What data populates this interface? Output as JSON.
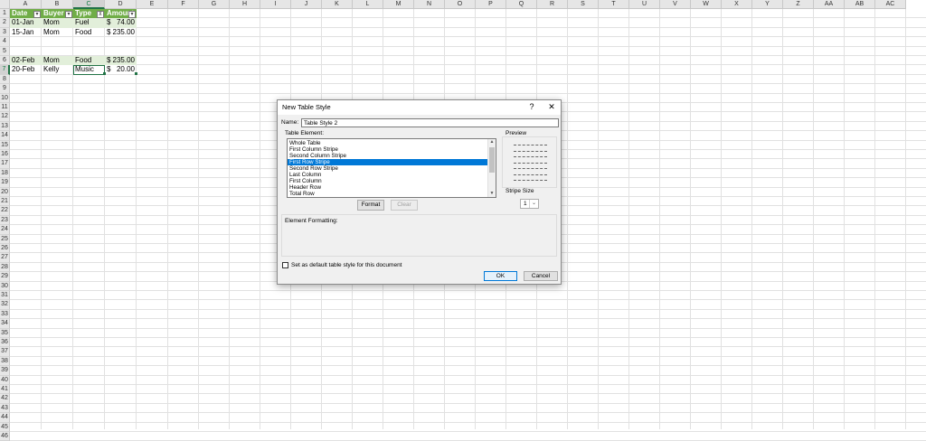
{
  "sheet": {
    "columns": [
      "A",
      "B",
      "C",
      "D",
      "E",
      "F",
      "G",
      "H",
      "I",
      "J",
      "K",
      "L",
      "M",
      "N",
      "O",
      "P",
      "Q",
      "R",
      "S",
      "T",
      "U",
      "V",
      "W",
      "X",
      "Y",
      "Z",
      "AA",
      "AB",
      "AC"
    ],
    "rows": [
      "1",
      "2",
      "3",
      "4",
      "5",
      "6",
      "7",
      "8",
      "9",
      "10",
      "11",
      "12",
      "13",
      "14",
      "15",
      "16",
      "17",
      "18",
      "19",
      "20",
      "21",
      "22",
      "23",
      "24",
      "25",
      "26",
      "27",
      "28",
      "29",
      "30",
      "31",
      "32",
      "33",
      "34",
      "35",
      "36",
      "37",
      "38",
      "39",
      "40",
      "41",
      "42",
      "43",
      "44",
      "45",
      "46"
    ],
    "table": {
      "headers": [
        "Date",
        "Buyer",
        "Type",
        "Amount"
      ],
      "header_colors": {
        "header": "#70ad47",
        "band": "#e2efda"
      },
      "rows": [
        {
          "row": "2",
          "date": "01-Jan",
          "buyer": "Mom",
          "type": "Fuel",
          "cur": "$",
          "amt": "74.00"
        },
        {
          "row": "3",
          "date": "15-Jan",
          "buyer": "Mom",
          "type": "Food",
          "cur": "$",
          "amt": "235.00"
        },
        {
          "row": "6",
          "date": "02-Feb",
          "buyer": "Mom",
          "type": "Food",
          "cur": "$",
          "amt": "235.00"
        },
        {
          "row": "7",
          "date": "20-Feb",
          "buyer": "Kelly",
          "type": "Music",
          "cur": "$",
          "amt": "20.00"
        }
      ]
    }
  },
  "dialog": {
    "title": "New Table Style",
    "help": "?",
    "close": "✕",
    "name_label": "Name:",
    "name_value": "Table Style 2",
    "table_element_label": "Table Element:",
    "elements": [
      "Whole Table",
      "First Column Stripe",
      "Second Column Stripe",
      "First Row Stripe",
      "Second Row Stripe",
      "Last Column",
      "First Column",
      "Header Row",
      "Total Row"
    ],
    "selected_element": "First Row Stripe",
    "preview_label": "Preview",
    "stripe_size_label": "Stripe Size",
    "stripe_size_value": "1",
    "format_button": "Format",
    "clear_button": "Clear",
    "element_formatting_label": "Element Formatting:",
    "default_checkbox_label": "Set as default table style for this document",
    "ok_button": "OK",
    "cancel_button": "Cancel",
    "accent_color": "#0078d7"
  }
}
